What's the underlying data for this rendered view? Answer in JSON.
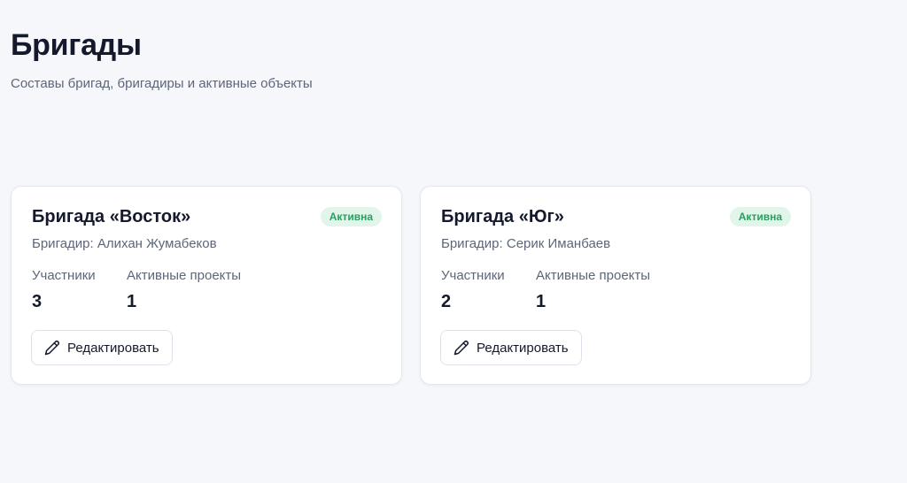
{
  "page": {
    "title": "Бригады",
    "subtitle": "Составы бригад, бригадиры и активные объекты"
  },
  "colors": {
    "background": "#f5f7fb",
    "card": "#ffffff",
    "badge_bg": "#e2f5ea",
    "badge_text": "#27a05e",
    "text_primary": "#141a2b",
    "text_secondary": "#5d6679"
  },
  "brigades": [
    {
      "name": "Бригада «Восток»",
      "status": "Активна",
      "foreman": "Бригадир: Алихан Жумабеков",
      "members_label": "Участники",
      "members_value": "3",
      "projects_label": "Активные проекты",
      "projects_value": "1",
      "edit_label": "Редактировать",
      "edit_icon": "pencil-icon"
    },
    {
      "name": "Бригада «Юг»",
      "status": "Активна",
      "foreman": "Бригадир: Серик Иманбаев",
      "members_label": "Участники",
      "members_value": "2",
      "projects_label": "Активные проекты",
      "projects_value": "1",
      "edit_label": "Редактировать",
      "edit_icon": "pencil-icon"
    }
  ]
}
